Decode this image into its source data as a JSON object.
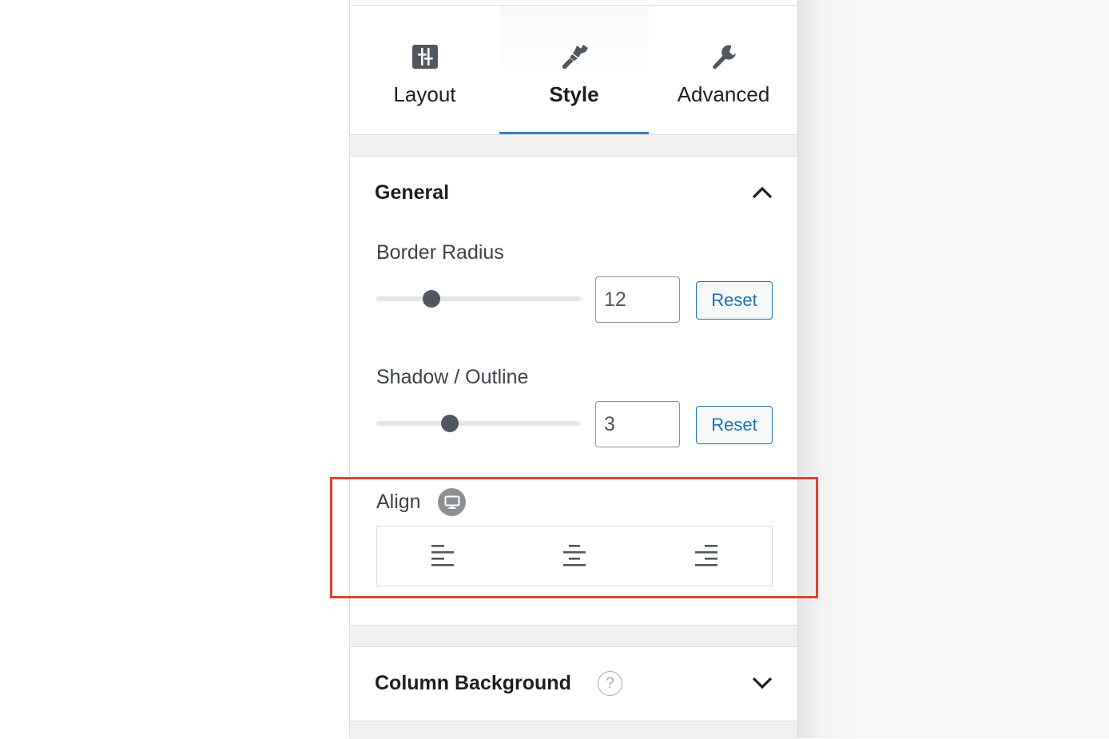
{
  "tabs": [
    {
      "label": "Layout",
      "icon": "sliders-icon",
      "active": false
    },
    {
      "label": "Style",
      "icon": "paintbrush-icon",
      "active": true
    },
    {
      "label": "Advanced",
      "icon": "wrench-icon",
      "active": false
    }
  ],
  "general": {
    "title": "General",
    "expanded": true,
    "border_radius": {
      "label": "Border Radius",
      "value": "12",
      "slider_fraction": 0.27,
      "reset_label": "Reset"
    },
    "shadow_outline": {
      "label": "Shadow / Outline",
      "value": "3",
      "slider_fraction": 0.36,
      "reset_label": "Reset"
    },
    "align": {
      "label": "Align",
      "device_icon": "desktop-icon",
      "options": [
        "align-left-icon",
        "align-center-icon",
        "align-right-icon"
      ]
    }
  },
  "column_background": {
    "title": "Column Background",
    "help_icon": "?",
    "expanded": false
  },
  "colors": {
    "accent": "#3582c4",
    "button_text": "#2271b1",
    "highlight_border": "#e0432f",
    "icon": "#50575e"
  }
}
